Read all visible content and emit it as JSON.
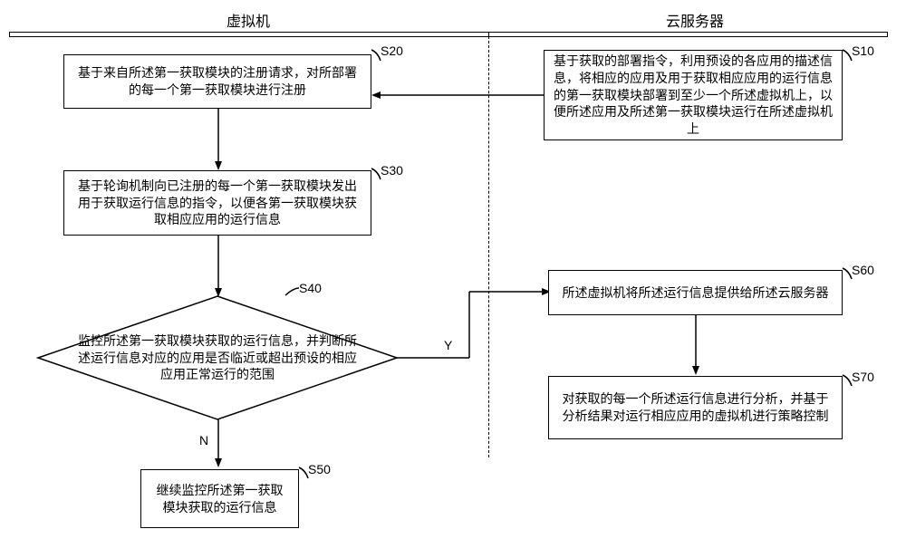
{
  "headers": {
    "left": "虚拟机",
    "right": "云服务器"
  },
  "labels": {
    "s10": "S10",
    "s20": "S20",
    "s30": "S30",
    "s40": "S40",
    "s50": "S50",
    "s60": "S60",
    "s70": "S70",
    "y": "Y",
    "n": "N"
  },
  "boxes": {
    "s10": "基于获取的部署指令，利用预设的各应用的描述信息，将相应的应用及用于获取相应应用的运行信息的第一获取模块部署到至少一个所述虚拟机上，以便所述应用及所述第一获取模块运行在所述虚拟机上",
    "s20": "基于来自所述第一获取模块的注册请求，对所部署的每一个第一获取模块进行注册",
    "s30": "基于轮询机制向已注册的每一个第一获取模块发出用于获取运行信息的指令，以便各第一获取模块获取相应应用的运行信息",
    "s40": "监控所述第一获取模块获取的运行信息，并判断所述运行信息对应的应用是否临近或超出预设的相应应用正常运行的范围",
    "s50": "继续监控所述第一获取模块获取的运行信息",
    "s60": "所述虚拟机将所述运行信息提供给所述云服务器",
    "s70": "对获取的每一个所述运行信息进行分析，并基于分析结果对运行相应应用的虚拟机进行策略控制"
  }
}
